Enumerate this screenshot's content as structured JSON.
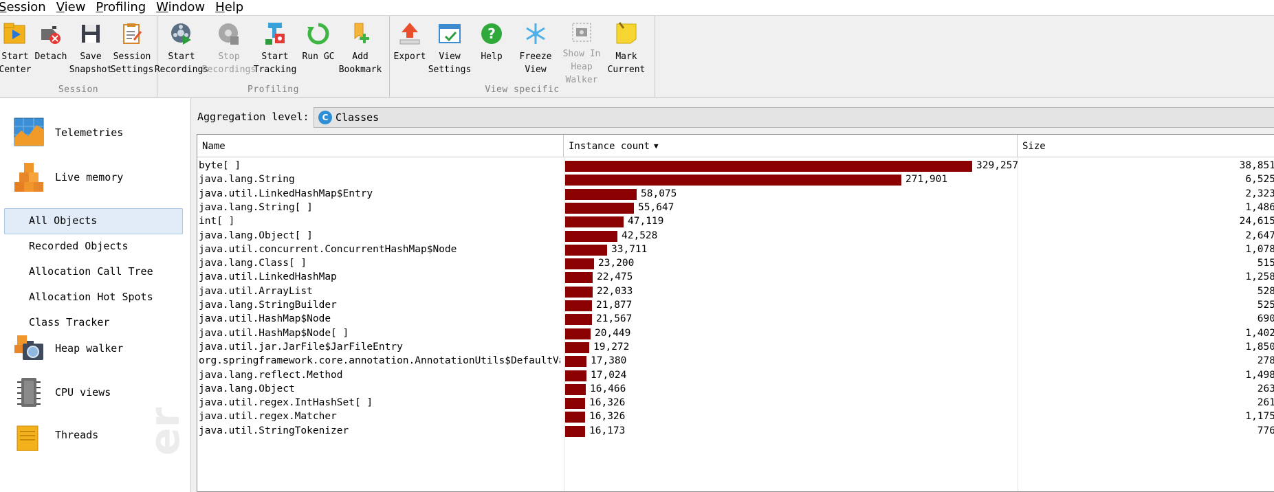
{
  "menu": [
    {
      "u": "S",
      "rest": "ession"
    },
    {
      "u": "V",
      "rest": "iew"
    },
    {
      "u": "P",
      "rest": "rofiling"
    },
    {
      "u": "W",
      "rest": "indow"
    },
    {
      "u": "H",
      "rest": "elp"
    }
  ],
  "toolbar": {
    "session": {
      "group_label": "Session",
      "start_center": "Start\nCenter",
      "detach": "Detach",
      "save_snapshot": "Save\nSnapshot",
      "session_settings": "Session\nSettings"
    },
    "profiling": {
      "group_label": "Profiling",
      "start_recordings": "Start\nRecordings",
      "stop_recordings": "Stop\nRecordings",
      "start_tracking": "Start\nTracking",
      "run_gc": "Run GC",
      "add_bookmark": "Add\nBookmark"
    },
    "view_specific": {
      "group_label": "View specific",
      "export": "Export",
      "view_settings": "View\nSettings",
      "help": "Help",
      "freeze_view": "Freeze\nView",
      "show_in_heap_walker": "Show In\nHeap Walker",
      "mark_current": "Mark\nCurrent"
    }
  },
  "sidebar": {
    "telemetries": "Telemetries",
    "live_memory": "Live memory",
    "all_objects": "All Objects",
    "recorded_objects": "Recorded Objects",
    "allocation_call_tree": "Allocation Call Tree",
    "allocation_hot_spots": "Allocation Hot Spots",
    "class_tracker": "Class Tracker",
    "heap_walker": "Heap walker",
    "cpu_views": "CPU views",
    "threads": "Threads",
    "watermark": "er"
  },
  "main": {
    "aggregation_label": "Aggregation level:",
    "aggregation_value": "Classes",
    "aggregation_badge": "C",
    "columns": {
      "name": "Name",
      "count": "Instance count",
      "size": "Size",
      "sort_indicator": "▼"
    },
    "max_count": 329257,
    "rows": [
      {
        "name": "byte[ ]",
        "count": 329257,
        "count_label": "329,257",
        "size": "38,851"
      },
      {
        "name": "java.lang.String",
        "count": 271901,
        "count_label": "271,901",
        "size": "6,525"
      },
      {
        "name": "java.util.LinkedHashMap$Entry",
        "count": 58075,
        "count_label": "58,075",
        "size": "2,323"
      },
      {
        "name": "java.lang.String[ ]",
        "count": 55647,
        "count_label": "55,647",
        "size": "1,486"
      },
      {
        "name": "int[ ]",
        "count": 47119,
        "count_label": "47,119",
        "size": "24,615"
      },
      {
        "name": "java.lang.Object[ ]",
        "count": 42528,
        "count_label": "42,528",
        "size": "2,647"
      },
      {
        "name": "java.util.concurrent.ConcurrentHashMap$Node",
        "count": 33711,
        "count_label": "33,711",
        "size": "1,078"
      },
      {
        "name": "java.lang.Class[ ]",
        "count": 23200,
        "count_label": "23,200",
        "size": "515"
      },
      {
        "name": "java.util.LinkedHashMap",
        "count": 22475,
        "count_label": "22,475",
        "size": "1,258"
      },
      {
        "name": "java.util.ArrayList",
        "count": 22033,
        "count_label": "22,033",
        "size": "528"
      },
      {
        "name": "java.lang.StringBuilder",
        "count": 21877,
        "count_label": "21,877",
        "size": "525"
      },
      {
        "name": "java.util.HashMap$Node",
        "count": 21567,
        "count_label": "21,567",
        "size": "690"
      },
      {
        "name": "java.util.HashMap$Node[ ]",
        "count": 20449,
        "count_label": "20,449",
        "size": "1,402"
      },
      {
        "name": "java.util.jar.JarFile$JarFileEntry",
        "count": 19272,
        "count_label": "19,272",
        "size": "1,850"
      },
      {
        "name": "org.springframework.core.annotation.AnnotationUtils$DefaultValueHo...",
        "count": 17380,
        "count_label": "17,380",
        "size": "278"
      },
      {
        "name": "java.lang.reflect.Method",
        "count": 17024,
        "count_label": "17,024",
        "size": "1,498"
      },
      {
        "name": "java.lang.Object",
        "count": 16466,
        "count_label": "16,466",
        "size": "263"
      },
      {
        "name": "java.util.regex.IntHashSet[ ]",
        "count": 16326,
        "count_label": "16,326",
        "size": "261"
      },
      {
        "name": "java.util.regex.Matcher",
        "count": 16326,
        "count_label": "16,326",
        "size": "1,175"
      },
      {
        "name": "java.util.StringTokenizer",
        "count": 16173,
        "count_label": "16,173",
        "size": "776"
      }
    ]
  },
  "colors": {
    "bar": "#8b0000",
    "selection": "#e1ecf8"
  }
}
